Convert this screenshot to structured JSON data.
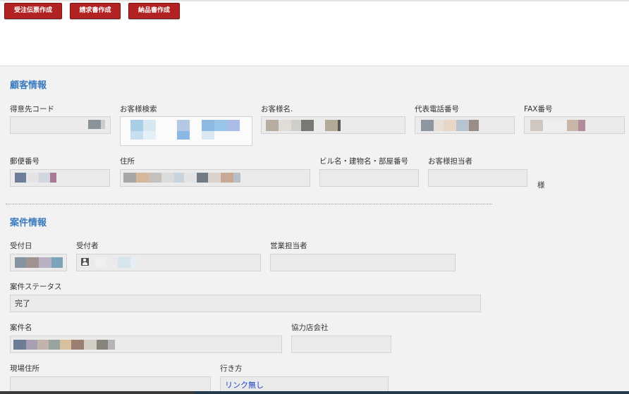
{
  "toolbar": {
    "order_slip_label": "受注伝票作成",
    "invoice_label": "請求書作成",
    "delivery_note_label": "納品書作成"
  },
  "customer": {
    "section_title": "顧客情報",
    "customer_code_label": "得意先コード",
    "customer_search_label": "お客様検索",
    "customer_name_label": "お客様名.",
    "phone_label": "代表電話番号",
    "fax_label": "FAX番号",
    "postal_label": "郵便番号",
    "address_label": "住所",
    "building_label": "ビル名・建物名・部屋番号",
    "contact_label": "お客様担当者",
    "honorific": "様"
  },
  "project": {
    "section_title": "案件情報",
    "received_date_label": "受付日",
    "receiver_label": "受付者",
    "sales_rep_label": "営業担当者",
    "status_label": "案件ステータス",
    "status_value": "完了",
    "name_label": "案件名",
    "partner_label": "協力店会社",
    "site_address_label": "現場住所",
    "directions_label": "行き方",
    "directions_value": "リンク無し"
  }
}
